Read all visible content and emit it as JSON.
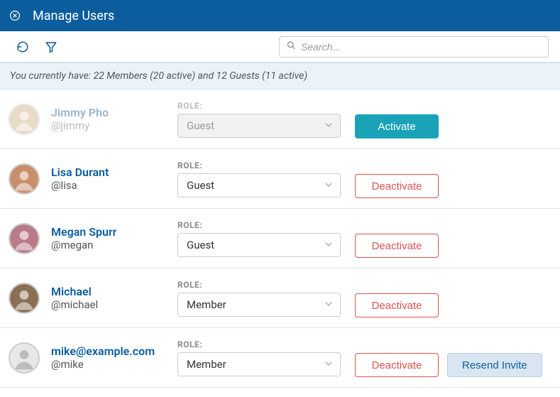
{
  "header": {
    "title": "Manage Users"
  },
  "search": {
    "placeholder": "Search..."
  },
  "summary": {
    "text": "You currently have: 22 Members (20 active) and 12 Guests (11 active)"
  },
  "labels": {
    "role": "ROLE:"
  },
  "buttons": {
    "activate": "Activate",
    "deactivate": "Deactivate",
    "resend": "Resend Invite"
  },
  "users": [
    {
      "name": "Jimmy Pho",
      "handle": "@jimmy",
      "role": "Guest",
      "active": false,
      "action": "activate",
      "resend": false,
      "avatar": "photo1"
    },
    {
      "name": "Lisa Durant",
      "handle": "@lisa",
      "role": "Guest",
      "active": true,
      "action": "deactivate",
      "resend": false,
      "avatar": "photo2"
    },
    {
      "name": "Megan Spurr",
      "handle": "@megan",
      "role": "Guest",
      "active": true,
      "action": "deactivate",
      "resend": false,
      "avatar": "photo3"
    },
    {
      "name": "Michael",
      "handle": "@michael",
      "role": "Member",
      "active": true,
      "action": "deactivate",
      "resend": false,
      "avatar": "photo4"
    },
    {
      "name": "mike@example.com",
      "handle": "@mike",
      "role": "Member",
      "active": true,
      "action": "deactivate",
      "resend": true,
      "avatar": "placeholder"
    }
  ]
}
